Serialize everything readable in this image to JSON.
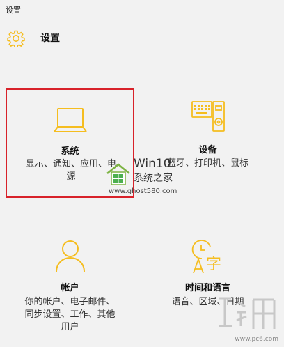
{
  "window": {
    "title": "设置"
  },
  "header": {
    "title": "设置",
    "icon": "gear-icon"
  },
  "tiles": [
    {
      "id": "system",
      "icon": "laptop-icon",
      "label": "系统",
      "desc": [
        "显示、通知、应用、电",
        "源"
      ],
      "selected": true
    },
    {
      "id": "devices",
      "icon": "devices-icon",
      "label": "设备",
      "desc": [
        "蓝牙、打印机、鼠标"
      ]
    },
    {
      "id": "accounts",
      "icon": "person-icon",
      "label": "帐户",
      "desc": [
        "你的帐户、电子邮件、",
        "同步设置、工作、其他",
        "用户"
      ]
    },
    {
      "id": "time",
      "icon": "clock-language-icon",
      "label": "时间和语言",
      "desc": [
        "语音、区域、日期"
      ]
    }
  ],
  "watermarks": {
    "center_brand": "Win10",
    "center_sub": "系统之家",
    "center_url": "www.ghost580.com",
    "corner_url": "www.pc6.com"
  },
  "colors": {
    "accent": "#f5bd1f",
    "selection_border": "#d8222a",
    "background": "#f2f2f2"
  }
}
